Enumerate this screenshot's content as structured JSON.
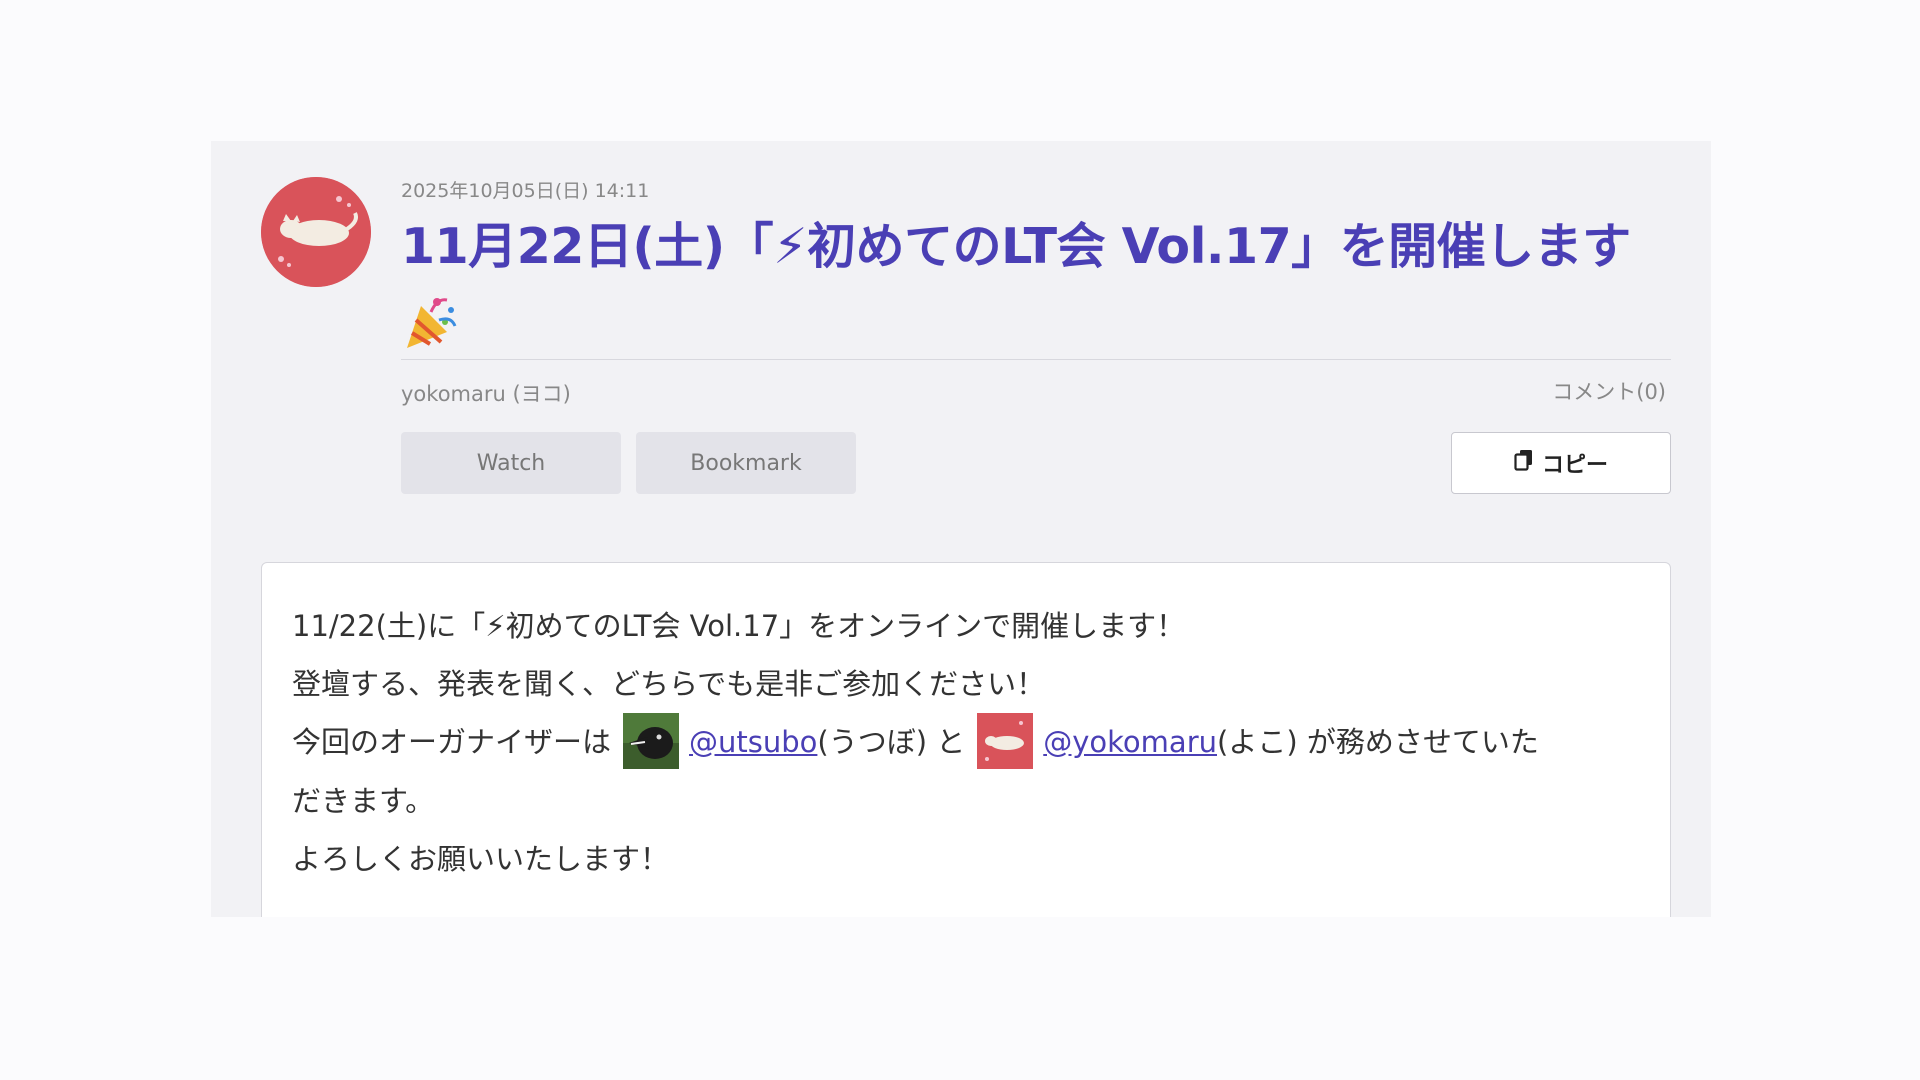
{
  "post": {
    "date": "2025年10月05日(日) 14:11",
    "title": "11月22日(土)「⚡初めてのLT会 Vol.17」を開催します",
    "author": "yokomaru (ヨコ)",
    "comments": "コメント(0)"
  },
  "actions": {
    "watch_label": "Watch",
    "bookmark_label": "Bookmark",
    "copy_label": "コピー"
  },
  "body": {
    "line1": "11/22(土)に「⚡初めてのLT会 Vol.17」をオンラインで開催します！",
    "line2": "登壇する、発表を聞く、どちらでも是非ご参加ください！",
    "line3_prefix": "今回のオーガナイザーは",
    "mention1": "@utsubo",
    "mention1_suffix": "(うつぼ) と",
    "mention2": "@yokomaru",
    "mention2_suffix": "(よこ) が務めさせていた",
    "line4": "だきます。",
    "line5": "よろしくお願いいたします！"
  },
  "colors": {
    "title": "#4a3fb5",
    "avatar_bg": "#d9535a",
    "utsubo_avatar_bg": "#4f7a3a"
  },
  "icons": {
    "avatar": "cat-avatar",
    "party": "party-popper-icon",
    "copy": "copy-icon"
  }
}
